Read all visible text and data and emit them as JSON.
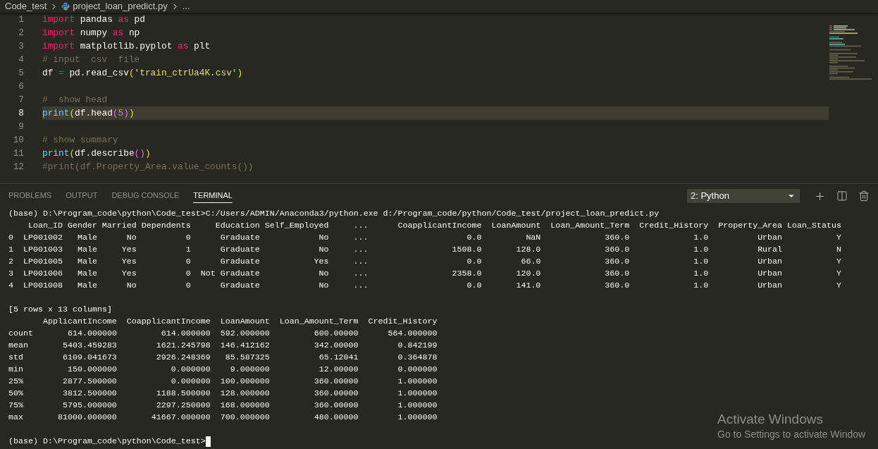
{
  "editor": {
    "breadcrumbs": [
      {
        "label": "Code_test",
        "kind": "folder"
      },
      {
        "label": "project_loan_predict.py",
        "kind": "python"
      },
      {
        "label": "...",
        "kind": "more"
      }
    ],
    "lines": [
      {
        "number": "1",
        "current": false,
        "tokens": [
          {
            "text": "import",
            "kind": "keyword"
          },
          {
            "text": " pandas ",
            "kind": "plain"
          },
          {
            "text": "as",
            "kind": "keyword"
          },
          {
            "text": " pd",
            "kind": "plain"
          }
        ]
      },
      {
        "number": "2",
        "current": false,
        "tokens": [
          {
            "text": "import",
            "kind": "keyword"
          },
          {
            "text": " numpy ",
            "kind": "plain"
          },
          {
            "text": "as",
            "kind": "keyword"
          },
          {
            "text": " np",
            "kind": "plain"
          }
        ]
      },
      {
        "number": "3",
        "current": false,
        "tokens": [
          {
            "text": "import",
            "kind": "keyword"
          },
          {
            "text": " matplotlib.pyplot ",
            "kind": "plain"
          },
          {
            "text": "as",
            "kind": "keyword"
          },
          {
            "text": " plt",
            "kind": "plain"
          }
        ]
      },
      {
        "number": "4",
        "current": false,
        "tokens": [
          {
            "text": "# input  csv  file",
            "kind": "comment"
          }
        ]
      },
      {
        "number": "5",
        "current": false,
        "tokens": [
          {
            "text": "df ",
            "kind": "plain"
          },
          {
            "text": "=",
            "kind": "keyword"
          },
          {
            "text": " pd.read_csv",
            "kind": "plain"
          },
          {
            "text": "(",
            "kind": "bracket1"
          },
          {
            "text": "'train_ctrUa4K.csv'",
            "kind": "string"
          },
          {
            "text": ")",
            "kind": "bracket1"
          }
        ]
      },
      {
        "number": "6",
        "current": false
      },
      {
        "number": "7",
        "current": false,
        "tokens": [
          {
            "text": "#  show head",
            "kind": "comment"
          }
        ]
      },
      {
        "number": "8",
        "current": true,
        "tokens": [
          {
            "text": "print",
            "kind": "function"
          },
          {
            "text": "(",
            "kind": "bracket1"
          },
          {
            "text": "df.head",
            "kind": "plain"
          },
          {
            "text": "(",
            "kind": "bracket2"
          },
          {
            "text": "5",
            "kind": "number"
          },
          {
            "text": ")",
            "kind": "bracket2"
          },
          {
            "text": ")",
            "kind": "bracket1"
          }
        ]
      },
      {
        "number": "9",
        "current": false
      },
      {
        "number": "10",
        "current": false,
        "tokens": [
          {
            "text": "# show summary",
            "kind": "comment"
          }
        ]
      },
      {
        "number": "11",
        "current": false,
        "tokens": [
          {
            "text": "print",
            "kind": "function"
          },
          {
            "text": "(",
            "kind": "bracket1"
          },
          {
            "text": "df.describe",
            "kind": "plain"
          },
          {
            "text": "()",
            "kind": "bracket2"
          },
          {
            "text": ")",
            "kind": "bracket1"
          }
        ]
      },
      {
        "number": "12",
        "current": false,
        "tokens": [
          {
            "text": "#print(df.Property_Area.value_counts())",
            "kind": "comment"
          }
        ]
      }
    ]
  },
  "panel": {
    "tabs": [
      {
        "label": "PROBLEMS",
        "selected": false
      },
      {
        "label": "OUTPUT",
        "selected": false
      },
      {
        "label": "DEBUG CONSOLE",
        "selected": false
      },
      {
        "label": "TERMINAL",
        "selected": true
      }
    ],
    "terminal_select": {
      "value": "2: Python"
    },
    "output": [
      {
        "kind": "line",
        "text": "(base) D:\\Program_code\\python\\Code_test>C:/Users/ADMIN/Anaconda3/python.exe d:/Program_code/python/Code_test/project_loan_predict.py"
      },
      {
        "kind": "dataframe",
        "columns": [
          "Loan_ID",
          "Gender",
          "Married",
          "Dependents",
          "Education",
          "Self_Employed",
          "...",
          "CoapplicantIncome",
          "LoanAmount",
          "Loan_Amount_Term",
          "Credit_History",
          "Property_Area",
          "Loan_Status"
        ],
        "rows": [
          {
            "index": "0",
            "cells": [
              "LP001002",
              "Male",
              "No",
              "0",
              "Graduate",
              "No",
              "...",
              "0.0",
              "NaN",
              "360.0",
              "1.0",
              "Urban",
              "Y"
            ]
          },
          {
            "index": "1",
            "cells": [
              "LP001003",
              "Male",
              "Yes",
              "1",
              "Graduate",
              "No",
              "...",
              "1508.0",
              "128.0",
              "360.0",
              "1.0",
              "Rural",
              "N"
            ]
          },
          {
            "index": "2",
            "cells": [
              "LP001005",
              "Male",
              "Yes",
              "0",
              "Graduate",
              "Yes",
              "...",
              "0.0",
              "66.0",
              "360.0",
              "1.0",
              "Urban",
              "Y"
            ]
          },
          {
            "index": "3",
            "cells": [
              "LP001006",
              "Male",
              "Yes",
              "0",
              "Not Graduate",
              "No",
              "...",
              "2358.0",
              "120.0",
              "360.0",
              "1.0",
              "Urban",
              "Y"
            ]
          },
          {
            "index": "4",
            "cells": [
              "LP001008",
              "Male",
              "No",
              "0",
              "Graduate",
              "No",
              "...",
              "0.0",
              "141.0",
              "360.0",
              "1.0",
              "Urban",
              "Y"
            ]
          }
        ]
      },
      {
        "kind": "blank"
      },
      {
        "kind": "line",
        "text": "[5 rows x 13 columns]"
      },
      {
        "kind": "describe",
        "columns": [
          "ApplicantIncome",
          "CoapplicantIncome",
          "LoanAmount",
          "Loan_Amount_Term",
          "Credit_History"
        ],
        "rows": [
          {
            "index": "count",
            "cells": [
              "614.000000",
              "614.000000",
              "592.000000",
              "600.00000",
              "564.000000"
            ]
          },
          {
            "index": "mean",
            "cells": [
              "5403.459283",
              "1621.245798",
              "146.412162",
              "342.00000",
              "0.842199"
            ]
          },
          {
            "index": "std",
            "cells": [
              "6109.041673",
              "2926.248369",
              "85.587325",
              "65.12041",
              "0.364878"
            ]
          },
          {
            "index": "min",
            "cells": [
              "150.000000",
              "0.000000",
              "9.000000",
              "12.00000",
              "0.000000"
            ]
          },
          {
            "index": "25%",
            "cells": [
              "2877.500000",
              "0.000000",
              "100.000000",
              "360.00000",
              "1.000000"
            ]
          },
          {
            "index": "50%",
            "cells": [
              "3812.500000",
              "1188.500000",
              "128.000000",
              "360.00000",
              "1.000000"
            ]
          },
          {
            "index": "75%",
            "cells": [
              "5795.000000",
              "2297.250000",
              "168.000000",
              "360.00000",
              "1.000000"
            ]
          },
          {
            "index": "max",
            "cells": [
              "81000.000000",
              "41667.000000",
              "700.000000",
              "480.00000",
              "1.000000"
            ]
          }
        ]
      },
      {
        "kind": "blank"
      },
      {
        "kind": "prompt",
        "text": "(base) D:\\Program_code\\python\\Code_test>"
      }
    ]
  },
  "activation_notice": {
    "title": "Activate Windows",
    "message": "Go to Settings to activate Window"
  }
}
